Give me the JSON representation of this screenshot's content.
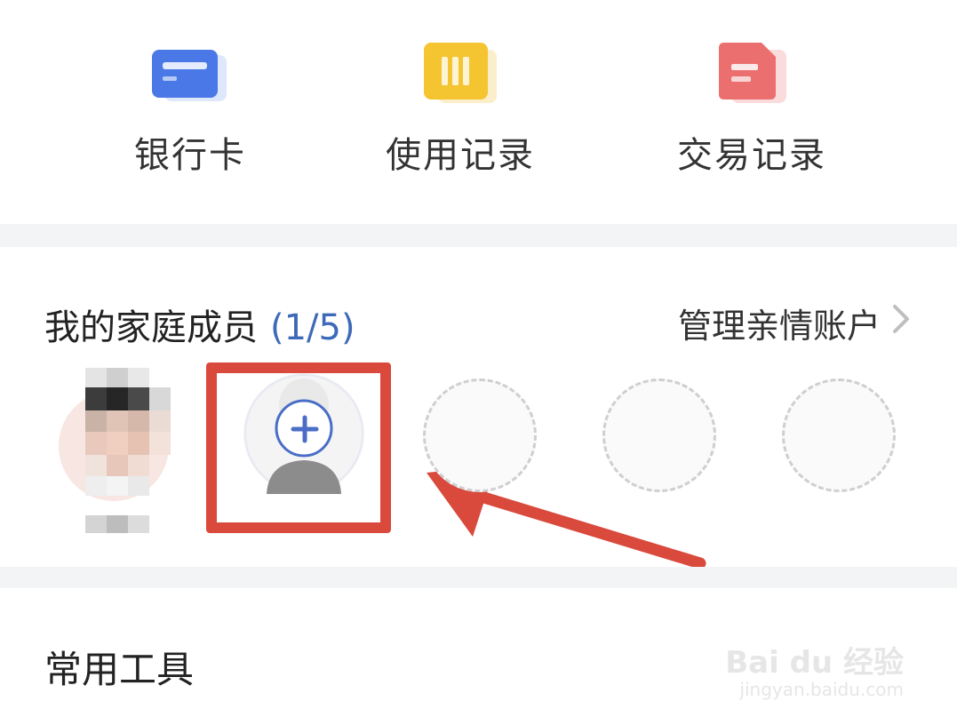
{
  "quick_actions": [
    {
      "label": "银行卡",
      "icon": "bank-card-icon",
      "color": "#4a78e6"
    },
    {
      "label": "使用记录",
      "icon": "usage-record-icon",
      "color": "#f5c531"
    },
    {
      "label": "交易记录",
      "icon": "transaction-record-icon",
      "color": "#ec6f6f"
    }
  ],
  "family": {
    "title": "我的家庭成员",
    "count": "(1/5)",
    "manage_label": "管理亲情账户",
    "add_icon": "plus-icon",
    "highlight_color": "#d9493c"
  },
  "tools": {
    "title": "常用工具"
  },
  "watermark": {
    "brand": "Bai du 经验",
    "url": "jingyan.baidu.com"
  }
}
